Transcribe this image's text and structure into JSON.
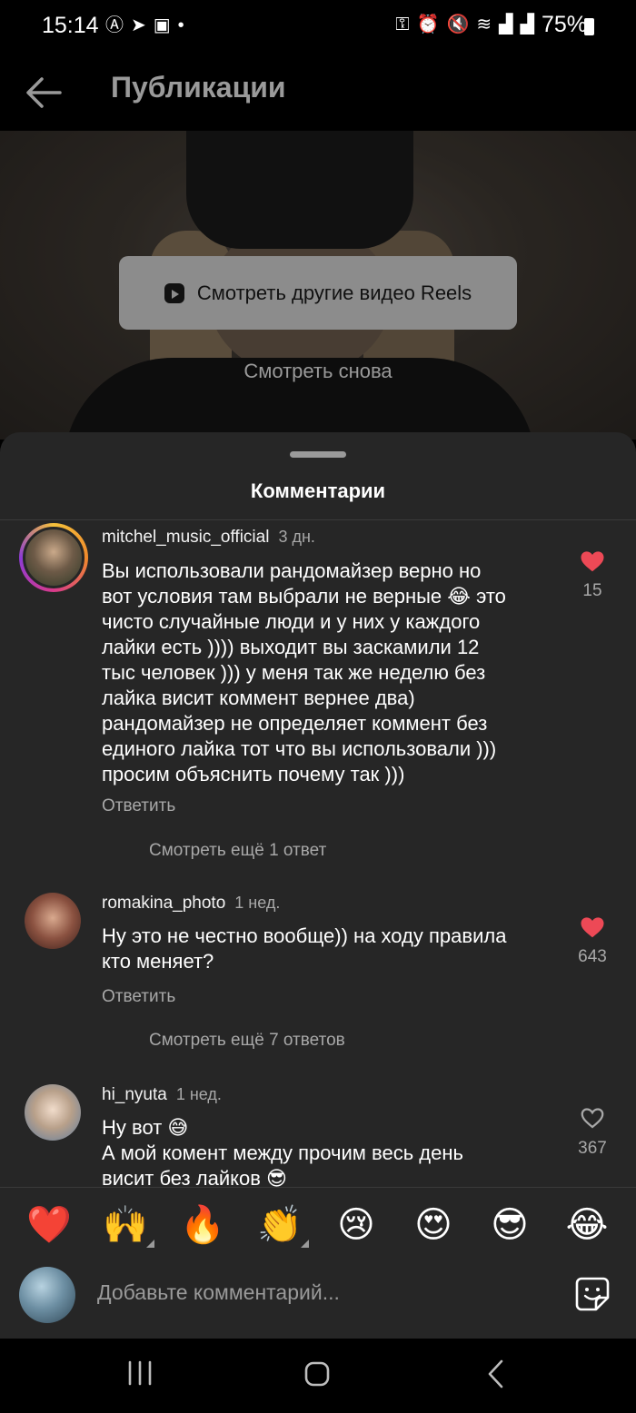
{
  "status_bar": {
    "time": "15:14",
    "battery": "75%",
    "left_icons": [
      "anarchy-icon",
      "telegram-icon",
      "teams-icon",
      "dot-icon"
    ],
    "right_icons": [
      "key-icon",
      "alarm-icon",
      "mute-icon",
      "wifi-icon",
      "signal-icon",
      "signal-icon",
      "battery-icon"
    ]
  },
  "header": {
    "title": "Публикации"
  },
  "video": {
    "reels_button_label": "Смотреть другие видео Reels",
    "replay_label": "Смотреть снова"
  },
  "comments_sheet": {
    "title": "Комментарии",
    "comments": [
      {
        "username": "mitchel_music_official",
        "time": "3 дн.",
        "text": "Вы использовали рандомайзер верно но\nвот условия там выбрали не верные 😂 это\nчисто случайные люди и у них у каждого\nлайки есть )))) выходит вы заскамили 12\nтыс человек ))) у меня так же неделю без\nлайка висит коммент вернее два)\nрандомайзер не определяет коммент без\nединого лайка тот что вы использовали )))\nпросим объяснить почему так )))",
        "reply_label": "Ответить",
        "likes": "15",
        "liked": true,
        "more_replies": "Смотреть ещё 1 ответ"
      },
      {
        "username": "romakina_photo",
        "time": "1 нед.",
        "text": "Ну это не честно вообще)) на ходу правила\nкто меняет?",
        "reply_label": "Ответить",
        "likes": "643",
        "liked": true,
        "more_replies": "Смотреть ещё 7 ответов"
      },
      {
        "username": "hi_nyuta",
        "time": "1 нед.",
        "text": "Ну вот 😅\nА мой комент между прочим весь день\nвисит без лайков 😎",
        "likes": "367",
        "liked": false
      }
    ]
  },
  "emoji_bar": [
    "❤️",
    "🙌",
    "🔥",
    "👏",
    "😢",
    "😍",
    "😎",
    "😂"
  ],
  "comment_input": {
    "placeholder": "Добавьте комментарий..."
  },
  "colors": {
    "liked_heart": "#ed4956",
    "sheet_bg": "#262626",
    "secondary_text": "#a8a8a8"
  }
}
